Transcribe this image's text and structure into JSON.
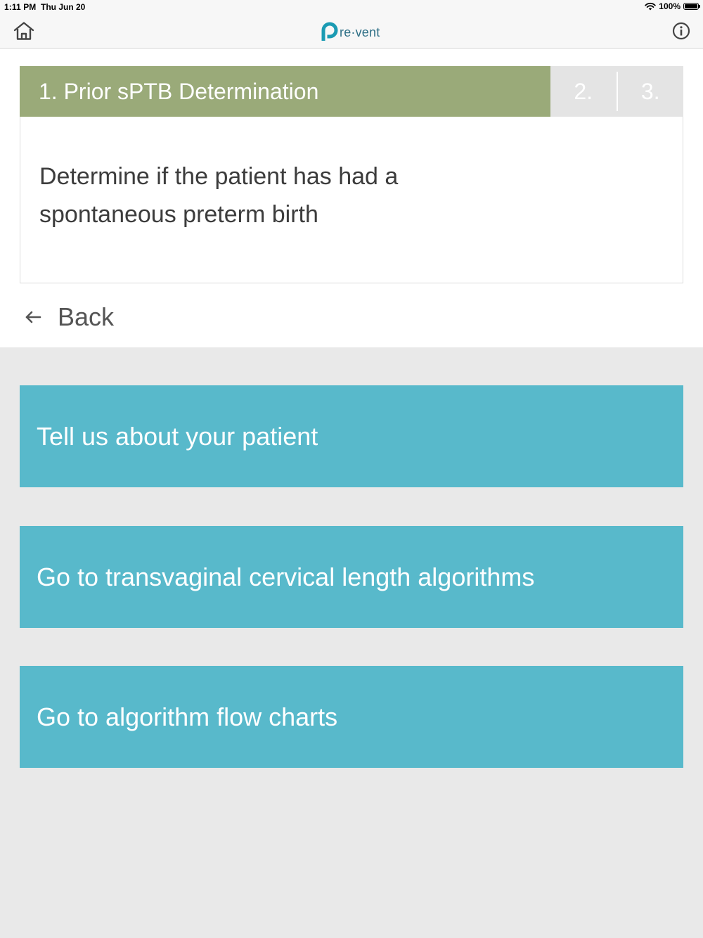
{
  "status_bar": {
    "time": "1:11 PM",
    "date": "Thu Jun 20",
    "battery_pct": "100%",
    "icons": [
      "wifi-icon",
      "battery-icon"
    ]
  },
  "nav": {
    "logo_text": "re·vent",
    "icons": [
      "home-icon",
      "info-icon"
    ],
    "brand_color": "#1b9bb3"
  },
  "steps": {
    "active": "1. Prior sPTB Determination",
    "step2": "2.",
    "step3": "3."
  },
  "description": "Determine if the patient has had a spontaneous preterm birth",
  "back": {
    "label": "Back",
    "icon": "arrow-left-icon"
  },
  "actions": [
    {
      "label": "Tell us about your patient"
    },
    {
      "label": "Go to transvaginal cervical length algorithms"
    },
    {
      "label": "Go to algorithm flow charts"
    }
  ],
  "colors": {
    "step_active_bg": "#9aaa79",
    "step_inactive_bg": "#e4e4e4",
    "action_bg": "#58b9cb",
    "page_bg": "#e9e9e9"
  }
}
